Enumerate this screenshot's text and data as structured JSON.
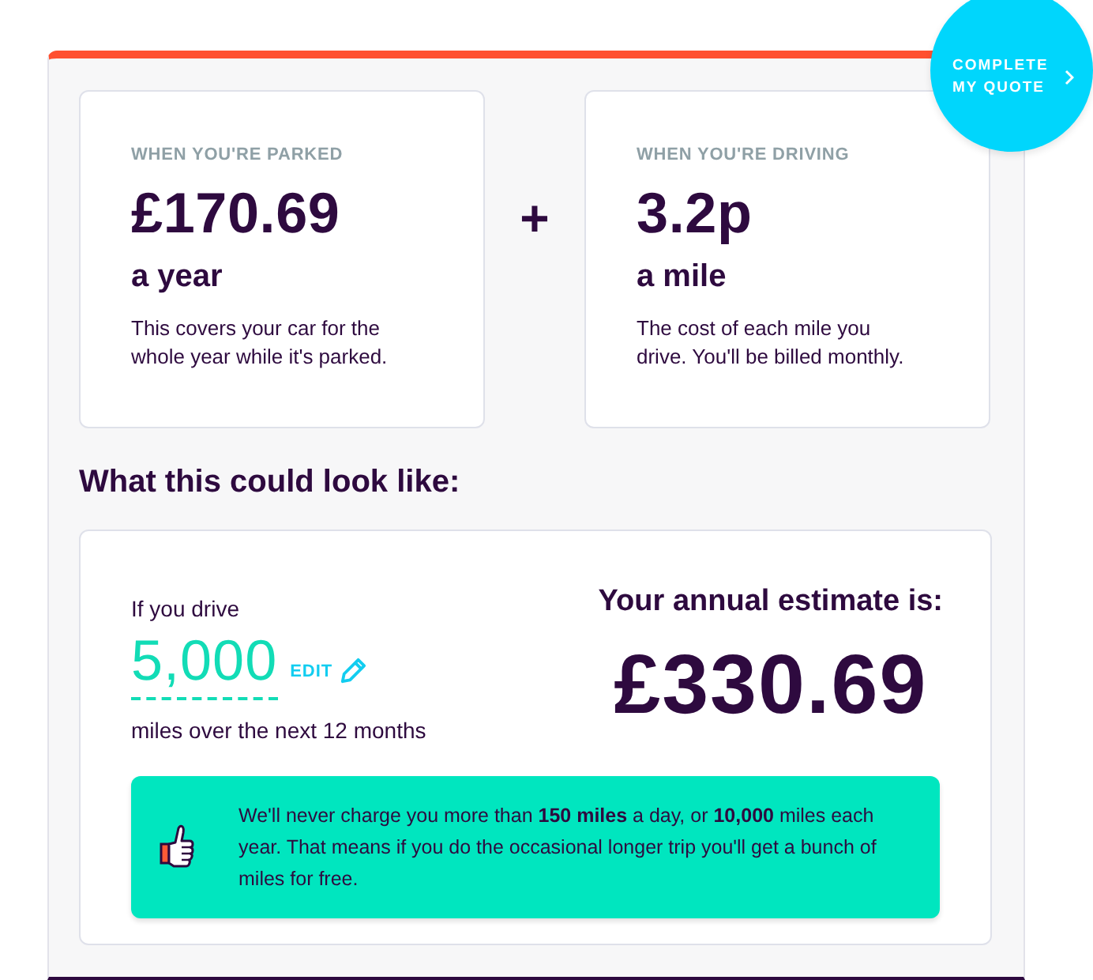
{
  "quote_button": {
    "label": "COMPLETE MY QUOTE"
  },
  "pricing_cards": [
    {
      "label": "WHEN YOU'RE PARKED",
      "price": "£170.69",
      "unit": "a year",
      "description": "This covers your car for the whole year while it's parked."
    },
    {
      "label": "WHEN YOU'RE DRIVING",
      "price": "3.2p",
      "unit": "a mile",
      "description": "The cost of each mile you drive. You'll be billed monthly."
    }
  ],
  "operator": "+",
  "section_heading": "What this could look like:",
  "estimate": {
    "intro": "If you drive",
    "miles_value": "5,000",
    "edit_label": "EDIT",
    "miles_caption": "miles over the next 12 months",
    "estimate_label": "Your annual estimate is:",
    "estimate_value": "£330.69"
  },
  "notice": {
    "text": "We'll never charge you more than **150 miles** a day, or **10,000** miles each year. That means if you do the occasional longer trip you'll get a bunch of miles for free."
  }
}
